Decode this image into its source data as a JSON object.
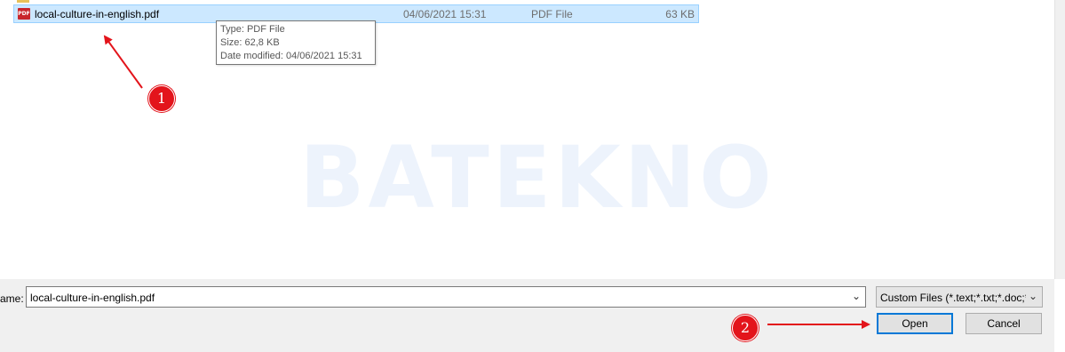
{
  "file_list": {
    "selected_file": {
      "name": "local-culture-in-english.pdf",
      "date_modified": "04/06/2021 15:31",
      "type": "PDF File",
      "size": "63 KB",
      "icon": "pdf-file-icon",
      "icon_text": "PDF"
    }
  },
  "tooltip": {
    "type_line": "Type: PDF File",
    "size_line": "Size: 62,8 KB",
    "date_line": "Date modified: 04/06/2021 15:31"
  },
  "watermark": "BATEKNO",
  "footer": {
    "file_name_label": "ame:",
    "file_name_value": "local-culture-in-english.pdf",
    "file_type_filter": "Custom Files (*.text;*.txt;*.doc;*",
    "open_label": "Open",
    "cancel_label": "Cancel"
  },
  "annotations": {
    "marker_1": "1",
    "marker_2": "2",
    "color": "#e3141b"
  },
  "colors": {
    "selection_bg": "#cce8ff",
    "selection_border": "#99d1ff",
    "default_button_border": "#0078d7"
  }
}
